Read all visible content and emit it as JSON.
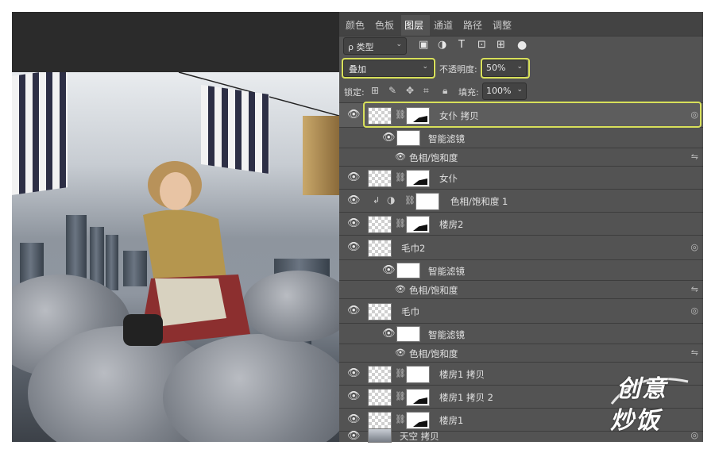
{
  "tabs": [
    "颜色",
    "色板",
    "图层",
    "通道",
    "路径",
    "调整"
  ],
  "active_tab": "图层",
  "filter": {
    "label": "ρ 类型"
  },
  "blend_mode": "叠加",
  "opacity": {
    "label": "不透明度:",
    "value": "50%"
  },
  "lock": {
    "label": "锁定:"
  },
  "fill": {
    "label": "填充:",
    "value": "100%"
  },
  "layers": [
    {
      "name": "女仆 拷贝"
    },
    {
      "name": "智能滤镜"
    },
    {
      "name": "色相/饱和度"
    },
    {
      "name": "女仆"
    },
    {
      "name": "色相/饱和度 1"
    },
    {
      "name": "楼房2"
    },
    {
      "name": "毛巾2"
    },
    {
      "name": "智能滤镜"
    },
    {
      "name": "色相/饱和度"
    },
    {
      "name": "毛巾"
    },
    {
      "name": "智能滤镜"
    },
    {
      "name": "色相/饱和度"
    },
    {
      "name": "楼房1 拷贝"
    },
    {
      "name": "楼房1 拷贝 2"
    },
    {
      "name": "楼房1"
    },
    {
      "name": "天空 拷贝"
    }
  ],
  "watermark": {
    "line1": "创意",
    "line2": "炒饭"
  },
  "icons": {
    "eye": "eye-icon",
    "chain": "link-icon",
    "smart": "smart-object-icon"
  }
}
